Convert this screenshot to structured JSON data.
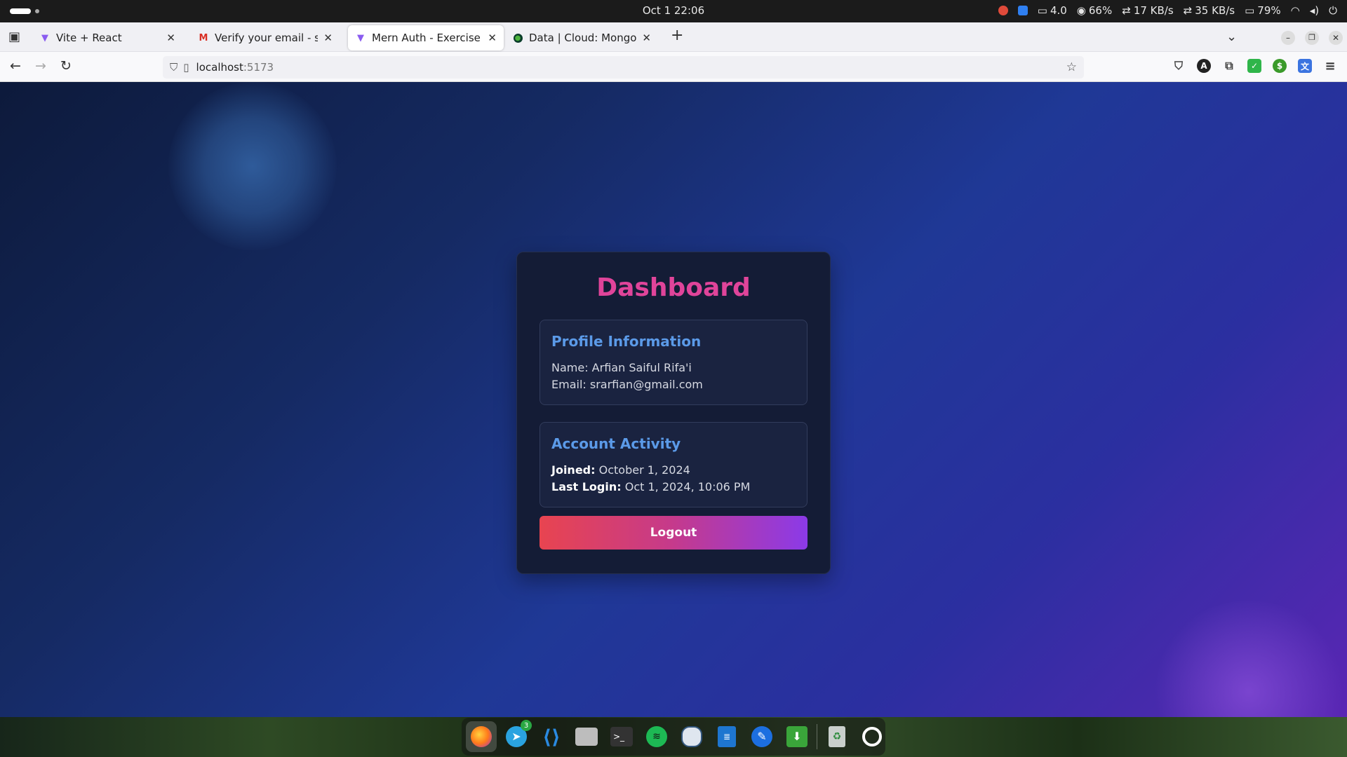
{
  "system_bar": {
    "clock": "Oct 1  22:06",
    "indicators": [
      "4.0",
      "66%",
      "17 KB/s",
      "35 KB/s",
      "79%"
    ]
  },
  "browser": {
    "tabs": [
      {
        "title": "Vite + React",
        "icon": "vite-icon",
        "active": false
      },
      {
        "title": "Verify your email - srarfian",
        "icon": "gmail-icon",
        "active": false
      },
      {
        "title": "Mern Auth - Exercise",
        "icon": "vite-icon",
        "active": true
      },
      {
        "title": "Data | Cloud: MongoDB C",
        "icon": "mongodb-icon",
        "active": false
      }
    ],
    "new_tab_label": "+",
    "url_host": "localhost",
    "url_port": ":5173"
  },
  "dashboard": {
    "title": "Dashboard",
    "profile": {
      "heading": "Profile Information",
      "name_line": "Name: Arfian Saiful Rifa'i",
      "email_line": "Email: srarfian@gmail.com"
    },
    "activity": {
      "heading": "Account Activity",
      "joined_label": "Joined:",
      "joined_value": " October 1, 2024",
      "last_login_label": "Last Login:",
      "last_login_value": " Oct 1, 2024, 10:06 PM"
    },
    "logout_label": "Logout"
  },
  "dock": {
    "apps": [
      "firefox-icon",
      "telegram-icon",
      "vscode-icon",
      "files-icon",
      "terminal-icon",
      "spotify-icon",
      "postgresql-icon",
      "writer-icon",
      "feather-icon",
      "download-icon",
      "trash-icon",
      "ubuntu-icon"
    ],
    "telegram_badge": "3"
  },
  "colors": {
    "title": "#e0449a",
    "heading": "#5b9ae8",
    "logout_gradient": [
      "#e84450",
      "#8b3ae8"
    ]
  }
}
